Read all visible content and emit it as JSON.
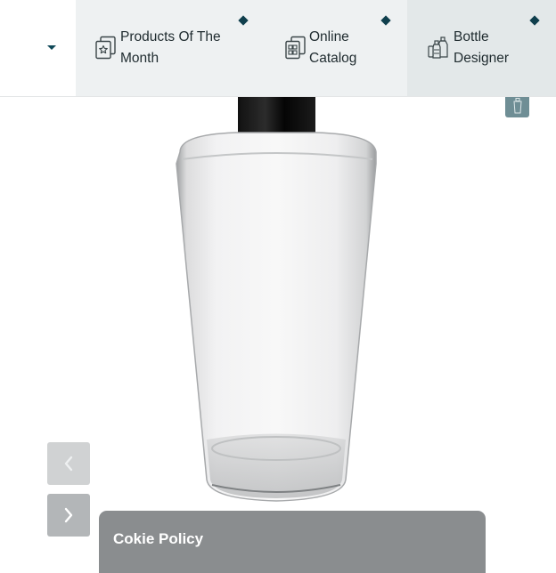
{
  "nav": {
    "menu_toggle_icon": "caret-down-icon",
    "items": [
      {
        "label": "Products Of The Month",
        "icon": "star-document-icon"
      },
      {
        "label": "Online Catalog",
        "icon": "catalog-icon"
      },
      {
        "label": "Bottle Designer",
        "icon": "bottles-icon"
      }
    ],
    "active_item": "Bottle Designer"
  },
  "product": {
    "image": "glass-bottle-with-black-cap",
    "thumbnail_icon": "bottle-thumbnail-icon"
  },
  "slider": {
    "prev_icon": "chevron-left-icon",
    "next_icon": "chevron-right-icon"
  },
  "cookie": {
    "title": "Cokie Policy"
  },
  "colors": {
    "brand_dark": "#0f4858",
    "nav_background": "#eef1f2",
    "nav_active_background": "#e3e8e9",
    "cookie_background": "#8a8d8f"
  }
}
